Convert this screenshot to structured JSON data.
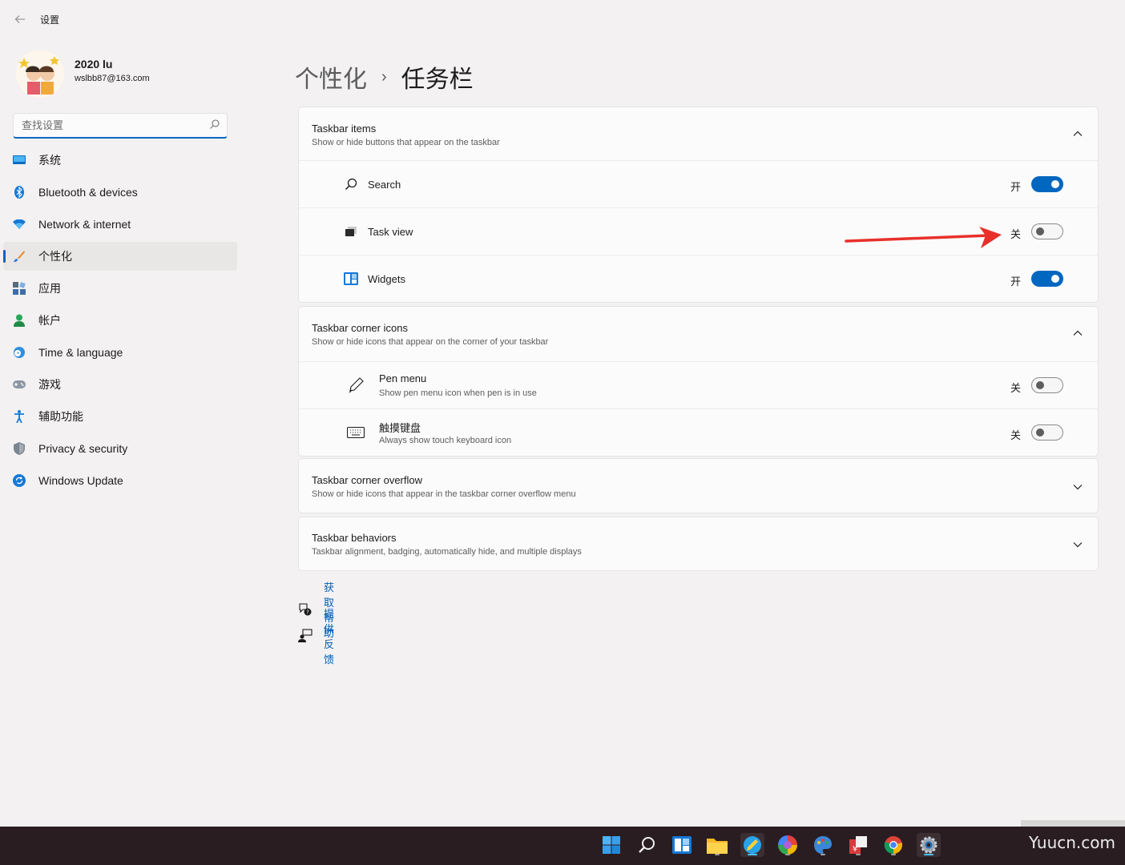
{
  "window": {
    "title": "设置"
  },
  "user": {
    "name": "2020 lu",
    "email": "wslbb87@163.com"
  },
  "search": {
    "placeholder": "查找设置"
  },
  "nav": {
    "items": [
      {
        "label": "系统",
        "icon": "system-icon"
      },
      {
        "label": "Bluetooth & devices",
        "icon": "bluetooth-icon"
      },
      {
        "label": "Network & internet",
        "icon": "wifi-icon"
      },
      {
        "label": "个性化",
        "icon": "brush-icon",
        "active": true
      },
      {
        "label": "应用",
        "icon": "apps-icon"
      },
      {
        "label": "帐户",
        "icon": "account-icon"
      },
      {
        "label": "Time & language",
        "icon": "globe-clock-icon"
      },
      {
        "label": "游戏",
        "icon": "gamepad-icon"
      },
      {
        "label": "辅助功能",
        "icon": "accessibility-icon"
      },
      {
        "label": "Privacy & security",
        "icon": "shield-icon"
      },
      {
        "label": "Windows Update",
        "icon": "update-icon"
      }
    ]
  },
  "breadcrumb": {
    "parent": "个性化",
    "separator": "›",
    "current": "任务栏"
  },
  "sections": {
    "items": {
      "title": "Taskbar items",
      "subtitle": "Show or hide buttons that appear on the taskbar",
      "rows": [
        {
          "label": "Search",
          "state": "开",
          "on": true
        },
        {
          "label": "Task view",
          "state": "关",
          "on": false
        },
        {
          "label": "Widgets",
          "state": "开",
          "on": true
        }
      ]
    },
    "corner": {
      "title": "Taskbar corner icons",
      "subtitle": "Show or hide icons that appear on the corner of your taskbar",
      "rows": [
        {
          "label": "Pen menu",
          "sub": "Show pen menu icon when pen is in use",
          "state": "关",
          "on": false
        },
        {
          "label": "触摸键盘",
          "sub": "Always show touch keyboard icon",
          "state": "关",
          "on": false
        }
      ]
    },
    "overflow": {
      "title": "Taskbar corner overflow",
      "subtitle": "Show or hide icons that appear in the taskbar corner overflow menu"
    },
    "behaviors": {
      "title": "Taskbar behaviors",
      "subtitle": "Taskbar alignment, badging, automatically hide, and multiple displays"
    }
  },
  "help": {
    "get_help": "获取帮助",
    "feedback": "提供反馈"
  },
  "taskbar": {
    "icons": [
      "start-icon",
      "search-icon",
      "widgets-icon",
      "file-explorer-icon",
      "pencil-app-icon",
      "color-app-icon",
      "paint-app-icon",
      "finance-app-icon",
      "chrome-icon",
      "settings-icon"
    ],
    "watermark": "Yuucn.com"
  },
  "colors": {
    "accent": "#0067c0",
    "arrow": "#e8302b",
    "taskbar": "#2a1d21"
  }
}
